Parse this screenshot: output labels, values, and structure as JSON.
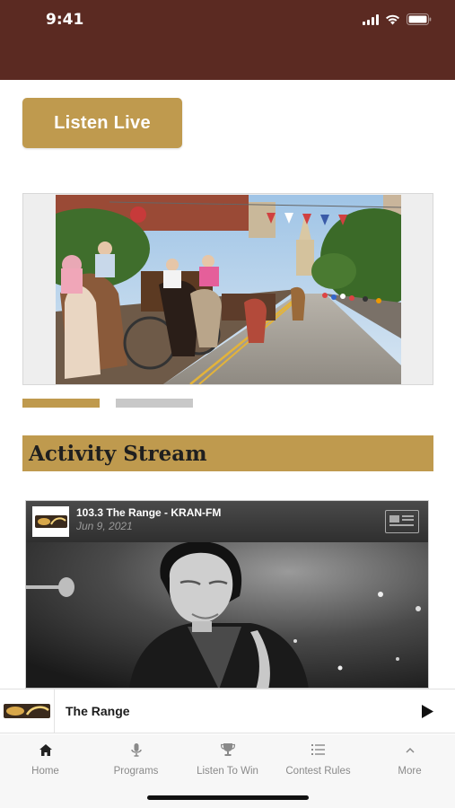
{
  "status_bar": {
    "time": "9:41"
  },
  "listen_live": {
    "label": "Listen Live"
  },
  "carousel": {
    "slide_count": 2,
    "active_index": 0
  },
  "activity_stream": {
    "heading": "Activity Stream"
  },
  "post": {
    "station": "103.3 The Range - KRAN-FM",
    "date": "Jun 9, 2021",
    "type_icon": "article-icon"
  },
  "player": {
    "title": "The Range",
    "state_icon": "play-icon"
  },
  "tabs": [
    {
      "label": "Home",
      "icon": "home-icon",
      "active": true
    },
    {
      "label": "Programs",
      "icon": "microphone-icon",
      "active": false
    },
    {
      "label": "Listen To Win",
      "icon": "trophy-icon",
      "active": false
    },
    {
      "label": "Contest Rules",
      "icon": "list-icon",
      "active": false
    },
    {
      "label": "More",
      "icon": "chevron-up-icon",
      "active": false
    }
  ],
  "colors": {
    "header": "#5b2a22",
    "accent": "#bf9a4e",
    "dot_inactive": "#c8c8c8"
  }
}
